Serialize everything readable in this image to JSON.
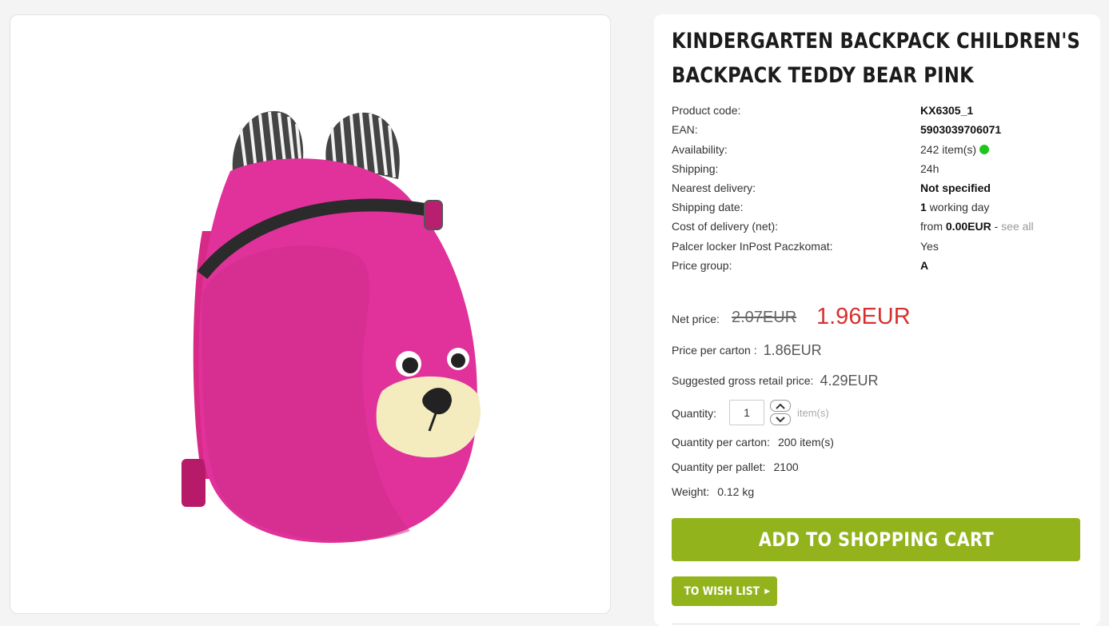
{
  "product": {
    "title_line1": "KINDERGARTEN BACKPACK CHILDREN'S",
    "title_line2": "BACKPACK TEDDY BEAR PINK",
    "image_icon": "teddy-bear-backpack-image"
  },
  "specs": {
    "product_code": {
      "label": "Product code:",
      "value": "KX6305_1"
    },
    "ean": {
      "label": "EAN:",
      "value": "5903039706071"
    },
    "availability": {
      "label": "Availability:",
      "value": "242 item(s)",
      "dot_color": "#1fc51f"
    },
    "shipping": {
      "label": "Shipping:",
      "value": "24h"
    },
    "nearest_delivery": {
      "label": "Nearest delivery:",
      "value": "Not specified"
    },
    "shipping_date": {
      "label": "Shipping date:",
      "value_number": "1",
      "value_text": " working day"
    },
    "delivery_cost": {
      "label": "Cost of delivery (net):",
      "prefix": "from ",
      "amount": "0.00EUR",
      "separator": " - ",
      "link": "see all"
    },
    "parcel_locker": {
      "label": "Palcer locker InPost Paczkomat:",
      "value": "Yes"
    },
    "price_group": {
      "label": "Price group:",
      "value": "A"
    }
  },
  "pricing": {
    "net_label": "Net price:",
    "old_price": "2.07EUR",
    "new_price": "1.96EUR",
    "carton_label": "Price per carton :",
    "carton_price": "1.86EUR",
    "retail_label": "Suggested gross retail price:",
    "retail_price": "4.29EUR",
    "new_price_color": "#d73030"
  },
  "quantity": {
    "label": "Quantity:",
    "value": "1",
    "unit": "item(s)"
  },
  "details": {
    "per_carton": {
      "label": "Quantity per carton:",
      "value": "200 item(s)"
    },
    "per_pallet": {
      "label": "Quantity per pallet:",
      "value": "2100"
    },
    "weight": {
      "label": "Weight:",
      "value": "0.12 kg"
    }
  },
  "actions": {
    "add_to_cart": "ADD TO SHOPPING CART",
    "wish_list": "TO WISH LIST",
    "button_color": "#92b31c"
  }
}
